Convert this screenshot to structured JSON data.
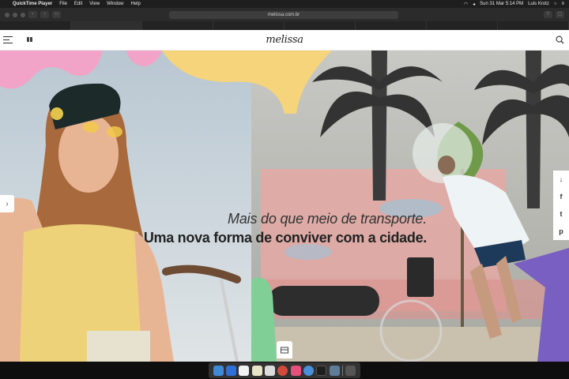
{
  "menubar": {
    "app_name": "QuickTime Player",
    "items": [
      "File",
      "Edit",
      "View",
      "Window",
      "Help"
    ],
    "datetime": "Sun 31 Mar  5:14 PM",
    "user": "Luis Krotz"
  },
  "browser": {
    "url": "melissa.com.br"
  },
  "site": {
    "logo": "melissa"
  },
  "hero": {
    "line1": "Mais do que meio de transporte.",
    "line2": "Uma nova forma de conviver com a cidade."
  },
  "share": {
    "download_icon": "↓",
    "facebook": "f",
    "twitter": "t",
    "pinterest": "p"
  },
  "colors": {
    "accent_purple": "#7a5fc3",
    "accent_pink": "#f2a3c8",
    "accent_yellow": "#f6d47b",
    "accent_green": "#7fcf97"
  }
}
